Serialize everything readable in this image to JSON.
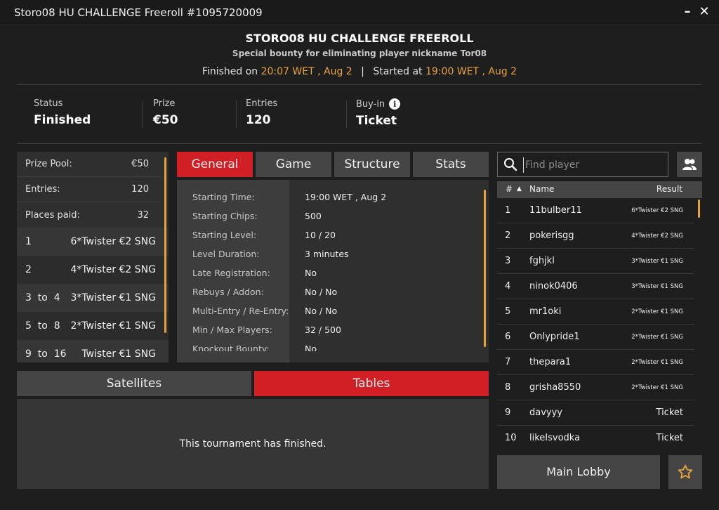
{
  "window": {
    "title": "Storo08 HU CHALLENGE Freeroll #1095720009",
    "minimize": "–",
    "close": "✕"
  },
  "header": {
    "title": "STORO08 HU CHALLENGE FREEROLL",
    "subtitle": "Special bounty for eliminating player nickname Tor08",
    "finished_label": "Finished on",
    "finished_value": "20:07 WET , Aug 2",
    "separator": "|",
    "started_label": "Started at",
    "started_value": "19:00 WET , Aug 2"
  },
  "stats": [
    {
      "label": "Status",
      "value": "Finished"
    },
    {
      "label": "Prize",
      "value": "€50"
    },
    {
      "label": "Entries",
      "value": "120"
    },
    {
      "label": "Buy-in",
      "value": "Ticket",
      "info": "i"
    }
  ],
  "prize_pool": {
    "summary": [
      {
        "label": "Prize Pool:",
        "value": "€50"
      },
      {
        "label": "Entries:",
        "value": "120"
      },
      {
        "label": "Places paid:",
        "value": "32"
      }
    ],
    "places": [
      {
        "place": "1",
        "prize": "6*Twister €2 SNG"
      },
      {
        "place": "2",
        "prize": "4*Twister €2 SNG"
      },
      {
        "place": "3  to  4",
        "prize": "3*Twister €1 SNG"
      },
      {
        "place": "5  to  8",
        "prize": "2*Twister €1 SNG"
      },
      {
        "place": "9  to  16",
        "prize": "Twister €1 SNG"
      }
    ]
  },
  "tabs": [
    "General",
    "Game",
    "Structure",
    "Stats"
  ],
  "general": [
    {
      "k": "Starting Time:",
      "v": "19:00 WET , Aug 2"
    },
    {
      "k": "Starting Chips:",
      "v": "500"
    },
    {
      "k": "Starting Level:",
      "v": "10 / 20"
    },
    {
      "k": "Level Duration:",
      "v": "3 minutes"
    },
    {
      "k": "Late Registration:",
      "v": "No"
    },
    {
      "k": "Rebuys / Addon:",
      "v": "No / No"
    },
    {
      "k": "Multi-Entry / Re-Entry:",
      "v": "No / No"
    },
    {
      "k": "Min / Max Players:",
      "v": "32 / 500"
    },
    {
      "k": "Knockout Bounty:",
      "v": "No"
    }
  ],
  "bottom_tabs": [
    "Satellites",
    "Tables"
  ],
  "finished_message": "This tournament has finished.",
  "search": {
    "placeholder": "Find player"
  },
  "player_list": {
    "headers": {
      "rank": "#",
      "sort": "▲",
      "name": "Name",
      "result": "Result"
    },
    "rows": [
      {
        "rank": "1",
        "name": "11bulber11",
        "result": "6*Twister €2 SNG"
      },
      {
        "rank": "2",
        "name": "pokerisgg",
        "result": "4*Twister €2 SNG"
      },
      {
        "rank": "3",
        "name": "fghjkl",
        "result": "3*Twister €1 SNG"
      },
      {
        "rank": "4",
        "name": "ninok0406",
        "result": "3*Twister €1 SNG"
      },
      {
        "rank": "5",
        "name": "mr1oki",
        "result": "2*Twister €1 SNG"
      },
      {
        "rank": "6",
        "name": "Onlypride1",
        "result": "2*Twister €1 SNG"
      },
      {
        "rank": "7",
        "name": "thepara1",
        "result": "2*Twister €1 SNG"
      },
      {
        "rank": "8",
        "name": "grisha8550",
        "result": "2*Twister €1 SNG"
      },
      {
        "rank": "9",
        "name": "davyyy",
        "result": "Ticket"
      },
      {
        "rank": "10",
        "name": "likeIsvodka",
        "result": "Ticket"
      }
    ]
  },
  "main_lobby_label": "Main Lobby",
  "colors": {
    "accent_red": "#d01f25",
    "accent_orange": "#e8a33a",
    "panel": "#2f2f2f"
  }
}
